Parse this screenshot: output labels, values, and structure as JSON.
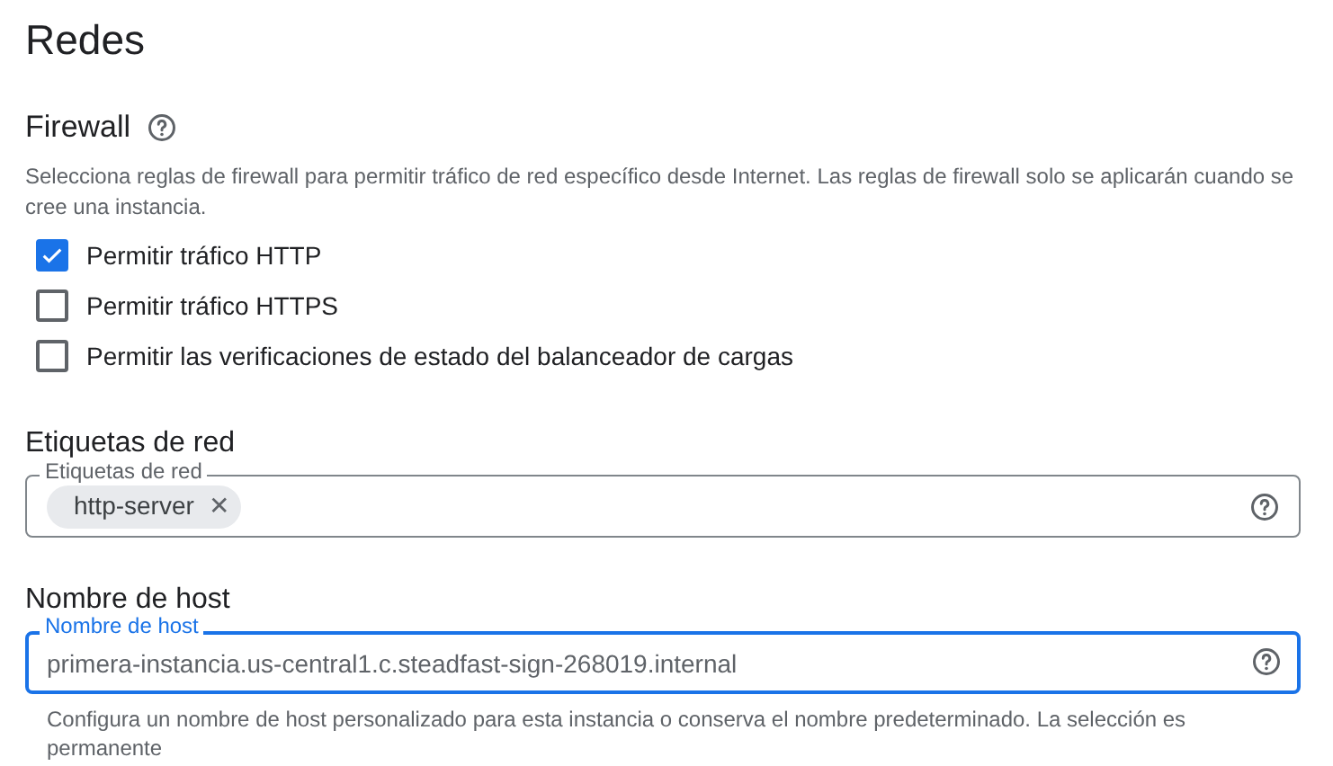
{
  "title": "Redes",
  "firewall": {
    "heading": "Firewall",
    "description": "Selecciona reglas de firewall para permitir tráfico de red específico desde Internet. Las reglas de firewall solo se aplicarán cuando se cree una instancia.",
    "options": [
      {
        "label": "Permitir tráfico HTTP",
        "checked": true
      },
      {
        "label": "Permitir tráfico HTTPS",
        "checked": false
      },
      {
        "label": "Permitir las verificaciones de estado del balanceador de cargas",
        "checked": false
      }
    ]
  },
  "network_tags": {
    "heading": "Etiquetas de red",
    "label": "Etiquetas de red",
    "focused": false,
    "chips": [
      {
        "label": "http-server",
        "remove": "✕"
      }
    ]
  },
  "hostname": {
    "heading": "Nombre de host",
    "label": "Nombre de host",
    "focused": true,
    "placeholder": "primera-instancia.us-central1.c.steadfast-sign-268019.internal",
    "hint": "Configura un nombre de host personalizado para esta instancia o conserva el nombre predeterminado. La selección es permanente"
  }
}
